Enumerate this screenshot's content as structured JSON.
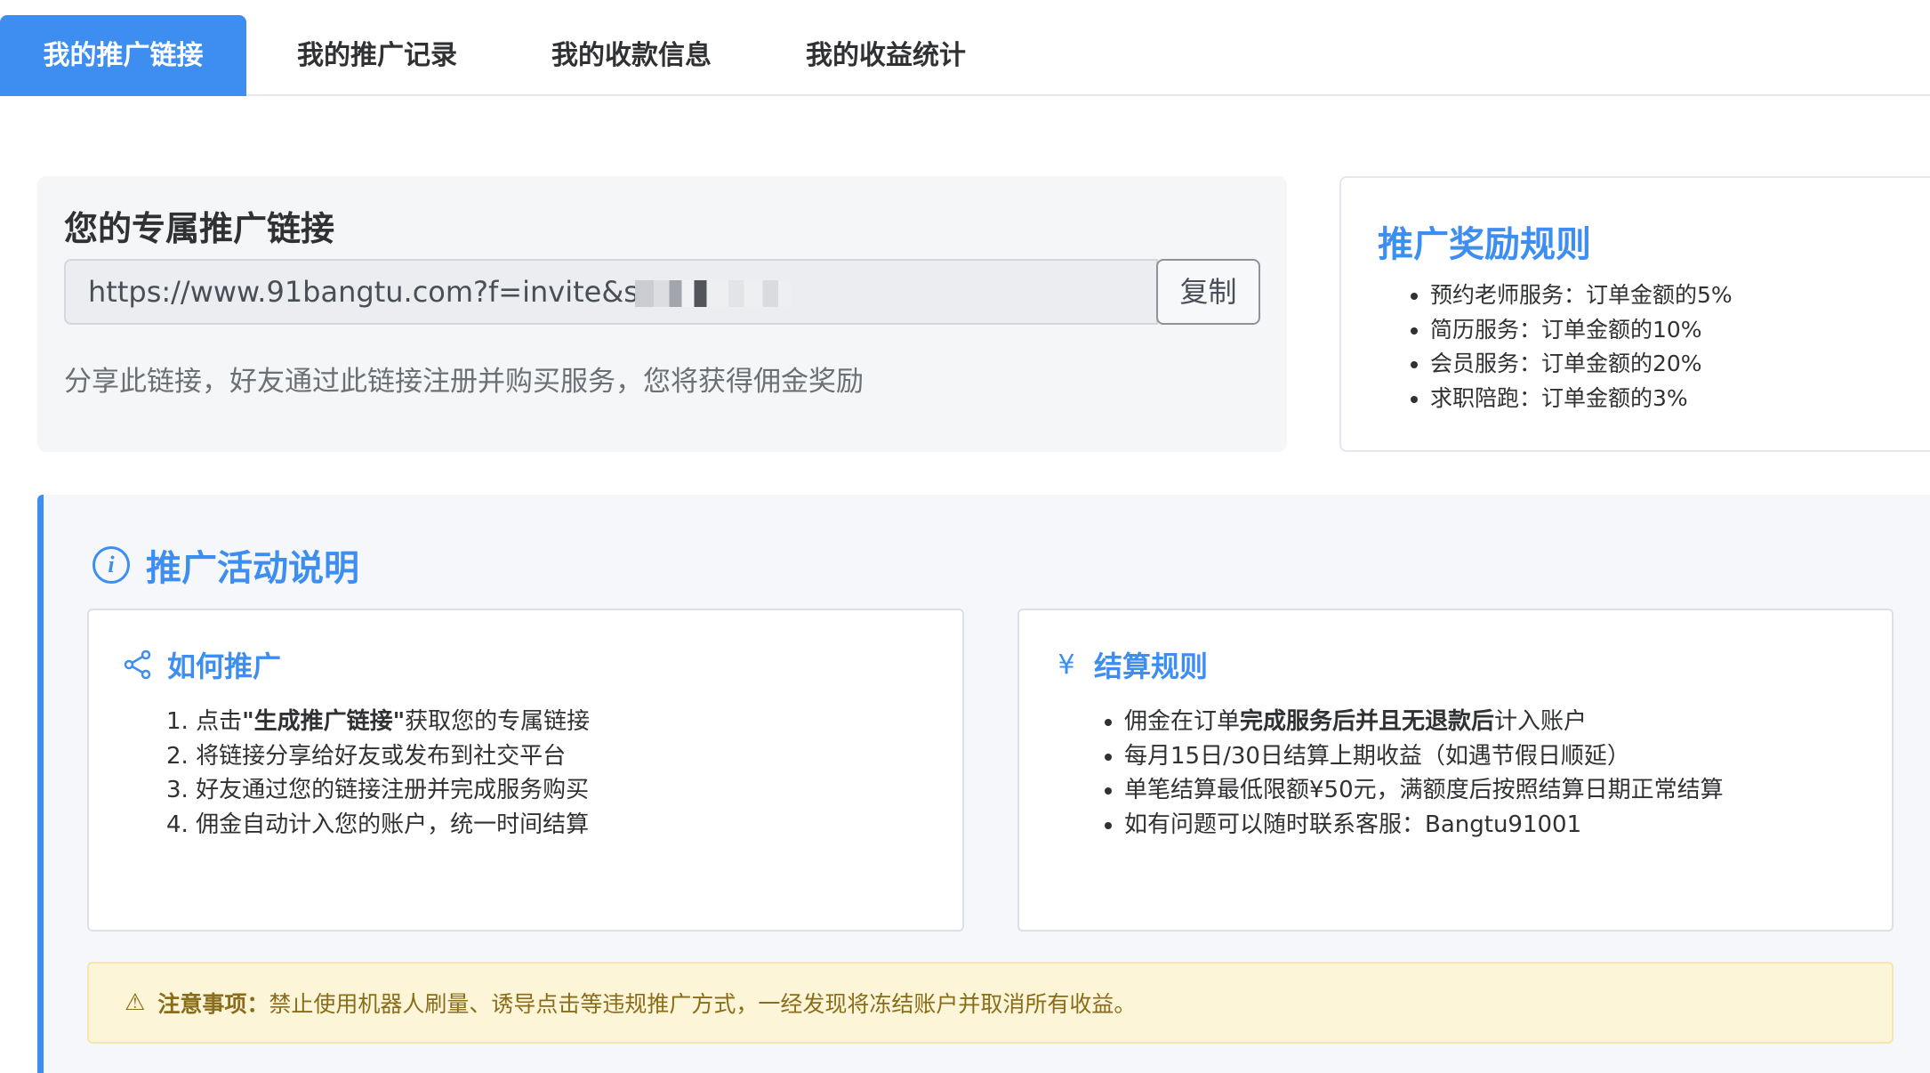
{
  "tabs": [
    {
      "label": "我的推广链接",
      "active": true
    },
    {
      "label": "我的推广记录",
      "active": false
    },
    {
      "label": "我的收款信息",
      "active": false
    },
    {
      "label": "我的收益统计",
      "active": false
    }
  ],
  "link_card": {
    "title": "您的专属推广链接",
    "link_value": "https://www.91bangtu.com?f=invite&s",
    "copy_label": "复制",
    "hint": "分享此链接，好友通过此链接注册并购买服务，您将获得佣金奖励"
  },
  "rules": {
    "title": "推广奖励规则",
    "items": [
      "预约老师服务：订单金额的5%",
      "简历服务：订单金额的10%",
      "会员服务：订单金额的20%",
      "求职陪跑：订单金额的3%"
    ]
  },
  "activity": {
    "icon": "info-icon",
    "title": "推广活动说明",
    "how": {
      "icon": "share-icon",
      "title": "如何推广",
      "step1_pre": "1. 点击",
      "step1_bold": "\"生成推广链接\"",
      "step1_post": "获取您的专属链接",
      "step2": "2. 将链接分享给好友或发布到社交平台",
      "step3": "3. 好友通过您的链接注册并完成服务购买",
      "step4": "4. 佣金自动计入您的账户，统一时间结算"
    },
    "settle": {
      "icon": "¥",
      "title": "结算规则",
      "item1_pre": "佣金在订单",
      "item1_bold": "完成服务后并且无退款后",
      "item1_post": "计入账户",
      "item2": "每月15日/30日结算上期收益（如遇节假日顺延）",
      "item3": "单笔结算最低限额¥50元，满额度后按照结算日期正常结算",
      "item4": "如有问题可以随时联系客服：Bangtu91001"
    },
    "warning": {
      "icon": "⚠",
      "label": "注意事项：",
      "text": "禁止使用机器人刷量、诱导点击等违规推广方式，一经发现将冻结账户并取消所有收益。"
    }
  },
  "colors": {
    "accent": "#3d8ef0",
    "warning_bg": "#fdf5d8",
    "warning_text": "#8a6d1a"
  }
}
